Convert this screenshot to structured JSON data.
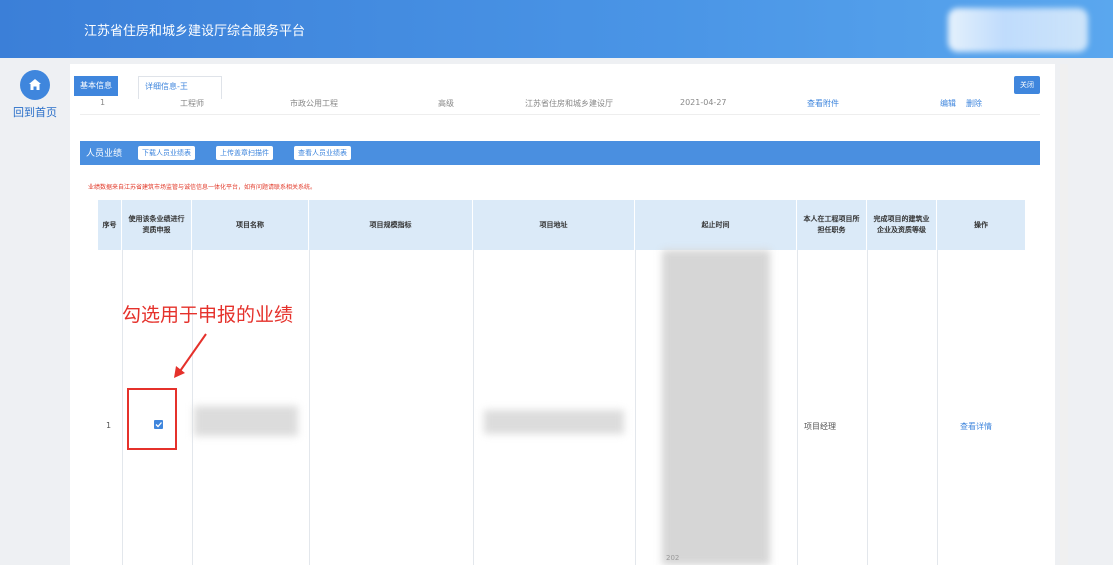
{
  "header": {
    "title": "江苏省住房和城乡建设厅综合服务平台"
  },
  "nav": {
    "home_label": "回到首页"
  },
  "tabs": [
    {
      "label": "基本信息"
    },
    {
      "label": "详细信息-王"
    }
  ],
  "close_label": "关闭",
  "prev_row": {
    "index": "1",
    "title": "工程师",
    "major": "市政公用工程",
    "level": "高级",
    "issuer": "江苏省住房和城乡建设厅",
    "date": "2021-04-27",
    "view_attachment": "查看附件",
    "edit": "编辑",
    "delete": "删除"
  },
  "section": {
    "title": "人员业绩",
    "buttons": [
      "下载人员业绩表",
      "上传盖章扫描件",
      "查看人员业绩表"
    ]
  },
  "notice": "业绩数据来自江苏省建筑市场监管与诚信信息一体化平台，如有问题请联系相关系统。",
  "table": {
    "headers": [
      "序号",
      "使用该条业绩进行资质申报",
      "项目名称",
      "项目规模指标",
      "项目地址",
      "起止时间",
      "本人在工程项目所担任职务",
      "完成项目的建筑业企业及资质等级",
      "操作"
    ],
    "rows": [
      {
        "index": "1",
        "checked": true,
        "role": "项目经理",
        "action": "查看详情",
        "time_partial": "202"
      }
    ]
  },
  "annotation": "勾选用于申报的业绩",
  "colors": {
    "accent": "#3f86dd",
    "annotation": "#e5312b",
    "header_bg": "#dbeaf8"
  }
}
